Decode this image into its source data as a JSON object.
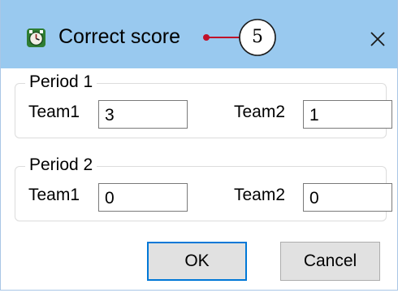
{
  "dialog": {
    "title": "Correct score",
    "icon": "clock-icon",
    "close_icon": "close-icon"
  },
  "annotation": {
    "number": "5",
    "color": "#c0102a"
  },
  "periods": [
    {
      "legend": "Period 1",
      "team1_label": "Team1",
      "team1_value": "3",
      "team2_label": "Team2",
      "team2_value": "1"
    },
    {
      "legend": "Period 2",
      "team1_label": "Team1",
      "team1_value": "0",
      "team2_label": "Team2",
      "team2_value": "0"
    }
  ],
  "buttons": {
    "ok_label": "OK",
    "cancel_label": "Cancel"
  },
  "colors": {
    "titlebar": "#99c9ef",
    "accent": "#0078d7",
    "icon_green": "#2e7d32"
  }
}
